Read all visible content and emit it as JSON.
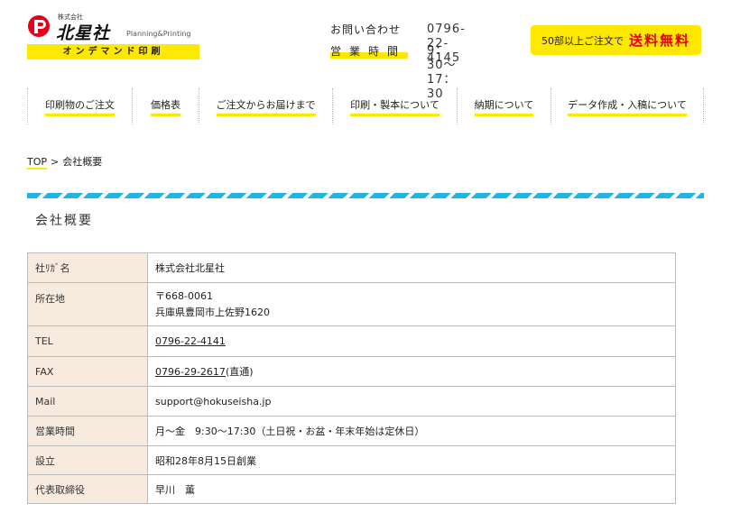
{
  "logo": {
    "small": "株式会社",
    "name": "北星社",
    "sub": "Planning&Printing",
    "band": "オンデマンド印刷"
  },
  "contact": {
    "inquiry_label": "お問い合わせ",
    "phone": "0796-22-4145",
    "hours_label": "営業時間",
    "hours": "9：30〜17：30"
  },
  "banner": {
    "text": "50部以上ご注文で",
    "highlight": "送料無料",
    "bg": "#ffe800",
    "highlight_color": "#e6001a"
  },
  "nav": {
    "items": [
      {
        "label": "印刷物のご注文"
      },
      {
        "label": "価格表"
      },
      {
        "label": "ご注文からお届けまで"
      },
      {
        "label": "印刷・製本について"
      },
      {
        "label": "納期について"
      },
      {
        "label": "データ作成・入稿について"
      }
    ]
  },
  "breadcrumb": {
    "top": "TOP",
    "sep": ">",
    "current": "会社概要"
  },
  "page": {
    "title": "会社概要"
  },
  "company": {
    "rows": [
      {
        "key": "社ﾘｶﾞ名",
        "value": "株式会社北星社"
      },
      {
        "key": "所在地",
        "value": "〒668-0061",
        "value2": "兵庫県豊岡市上佐野1620"
      },
      {
        "key": "TEL",
        "value": "0796-22-4141"
      },
      {
        "key": "FAX",
        "value": "0796-29-2617",
        "value_suffix": "(直通)"
      },
      {
        "key": "Mail",
        "value": "support@hokuseisha.jp"
      },
      {
        "key": "営業時間",
        "value": "月〜金　9:30〜17:30（土日祝・お盆・年末年始は定休日）"
      },
      {
        "key": "設立",
        "value": "昭和28年8月15日創業"
      },
      {
        "key": "代表取締役",
        "value": "早川　薫"
      }
    ]
  },
  "colors": {
    "accent": "#ffe800",
    "stripe": "#1fb6e6",
    "key_bg": "#f7ebe0"
  }
}
